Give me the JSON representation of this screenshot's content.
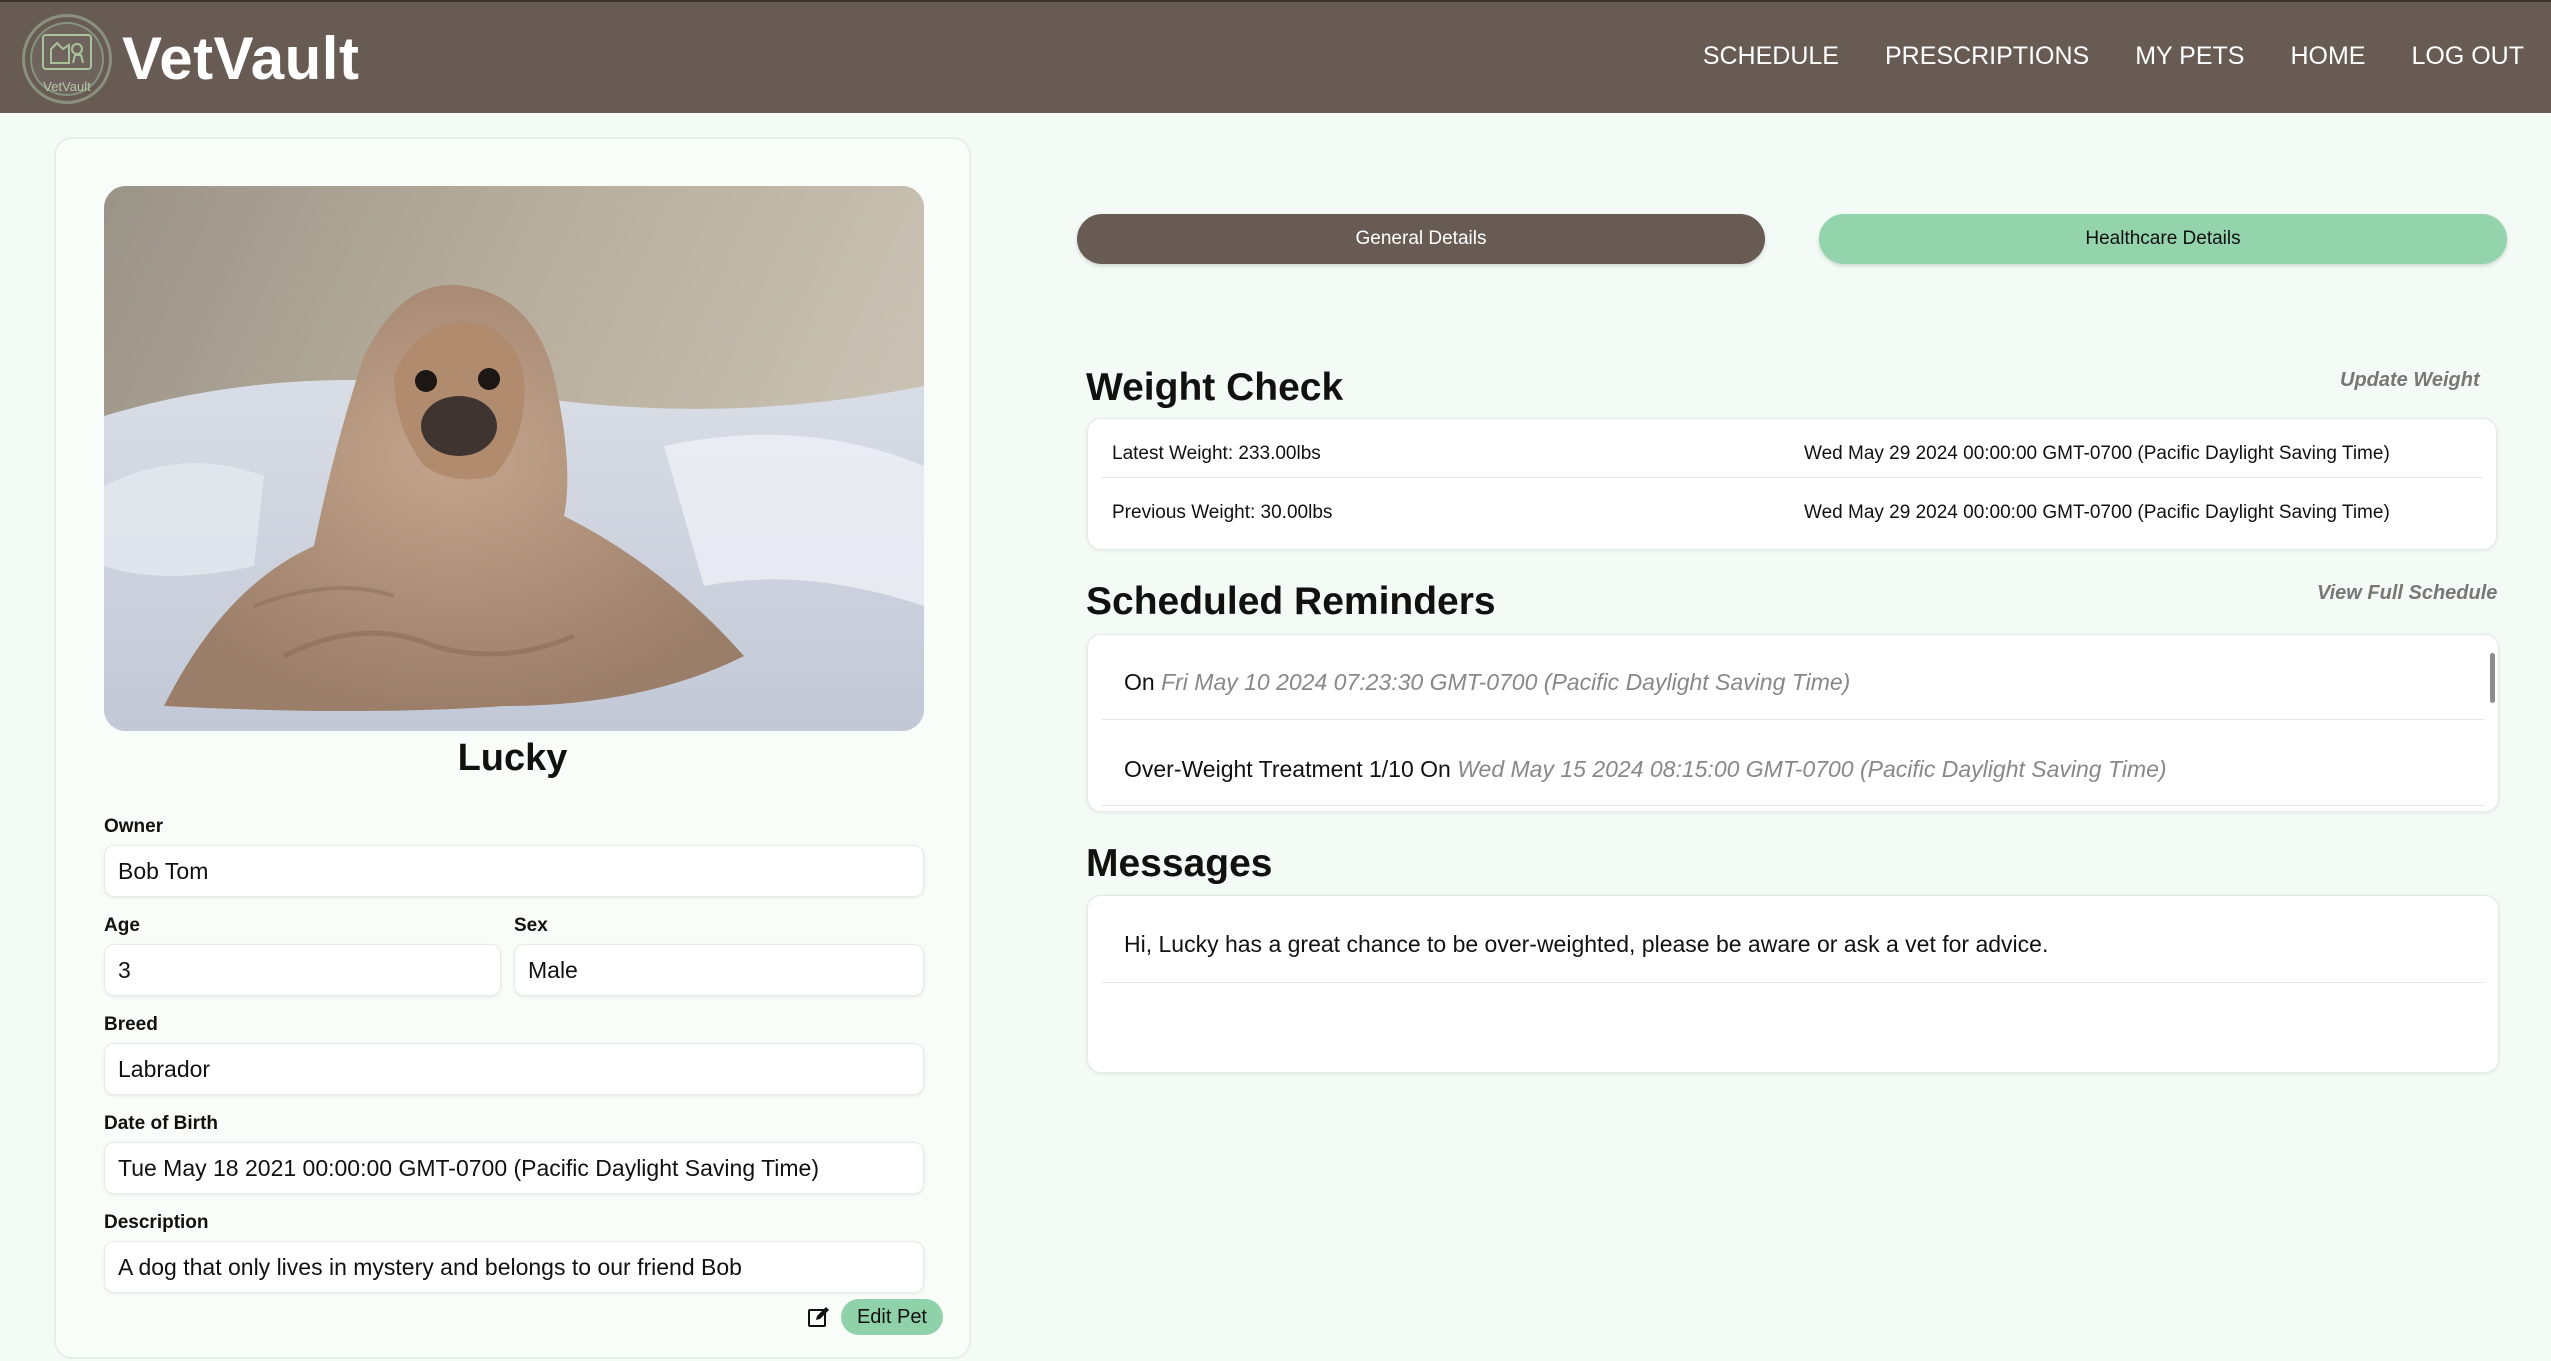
{
  "header": {
    "brand": "VetVault",
    "logo_text": "VetVault",
    "nav": [
      "SCHEDULE",
      "PRESCRIPTIONS",
      "MY PETS",
      "HOME",
      "LOG OUT"
    ]
  },
  "pet": {
    "name": "Lucky",
    "owner_label": "Owner",
    "owner": "Bob Tom",
    "age_label": "Age",
    "age": "3",
    "sex_label": "Sex",
    "sex": "Male",
    "breed_label": "Breed",
    "breed": "Labrador",
    "dob_label": "Date of Birth",
    "dob": "Tue May 18 2021 00:00:00 GMT-0700 (Pacific Daylight Saving Time)",
    "description_label": "Description",
    "description": "A dog that only lives in mystery and belongs to our friend Bob",
    "edit_label": "Edit Pet"
  },
  "tabs": {
    "general": "General Details",
    "healthcare": "Healthcare Details"
  },
  "weight": {
    "title": "Weight Check",
    "update_link": "Update Weight",
    "rows": [
      {
        "label": "Latest Weight: 233.00lbs",
        "date": "Wed May 29 2024 00:00:00 GMT-0700 (Pacific Daylight Saving Time)"
      },
      {
        "label": "Previous Weight: 30.00lbs",
        "date": "Wed May 29 2024 00:00:00 GMT-0700 (Pacific Daylight Saving Time)"
      }
    ]
  },
  "reminders": {
    "title": "Scheduled Reminders",
    "view_link": "View Full Schedule",
    "items": [
      {
        "prefix": "On",
        "date": "Fri May 10 2024 07:23:30 GMT-0700 (Pacific Daylight Saving Time)"
      },
      {
        "prefix": "Over-Weight Treatment 1/10 On",
        "date": "Wed May 15 2024 08:15:00 GMT-0700 (Pacific Daylight Saving Time)"
      }
    ]
  },
  "messages": {
    "title": "Messages",
    "items": [
      "Hi, Lucky has a great chance to be over-weighted, please be aware or ask a vet for advice."
    ]
  },
  "colors": {
    "header_bg": "#675b54",
    "accent_green": "#93d4ac",
    "page_bg": "#f4fbf6"
  },
  "icons": [
    "vetvault-logo-icon",
    "edit-icon"
  ]
}
